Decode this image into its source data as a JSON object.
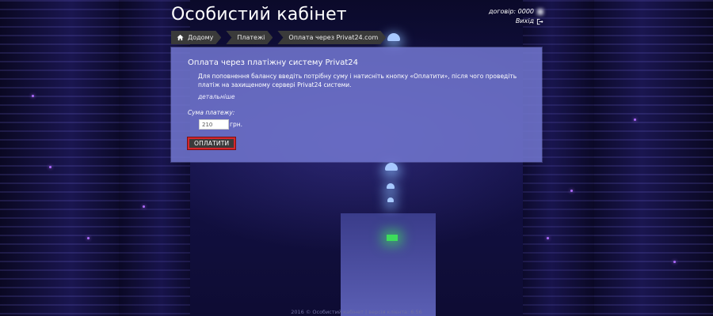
{
  "header": {
    "title": "Особистий кабінет",
    "contract_label": "договір: 0000",
    "logout_label": "Вихід"
  },
  "breadcrumb": [
    {
      "label": "Додому"
    },
    {
      "label": "Платежі"
    },
    {
      "label": "Оплата через Privat24.com"
    }
  ],
  "panel": {
    "heading": "Оплата через платіжну систему Privat24",
    "description": "Для поповнення балансу введіть потрібну суму і натисніть кнопку «Оплатити», після чого проведіть платіж на захищеному сервері Privat24 системи.",
    "details_link": "детальніше",
    "amount_label": "Сума платежу:",
    "amount_value": "210",
    "currency": "грн.",
    "pay_button": "ОПЛАТИТИ"
  },
  "footer": {
    "text": "2016 © Особистий кабінет | версія клієнта: 6.56"
  },
  "colors": {
    "panel": "#7074cd",
    "crumb": "#3a3a3a",
    "button_border": "#d4262b"
  }
}
